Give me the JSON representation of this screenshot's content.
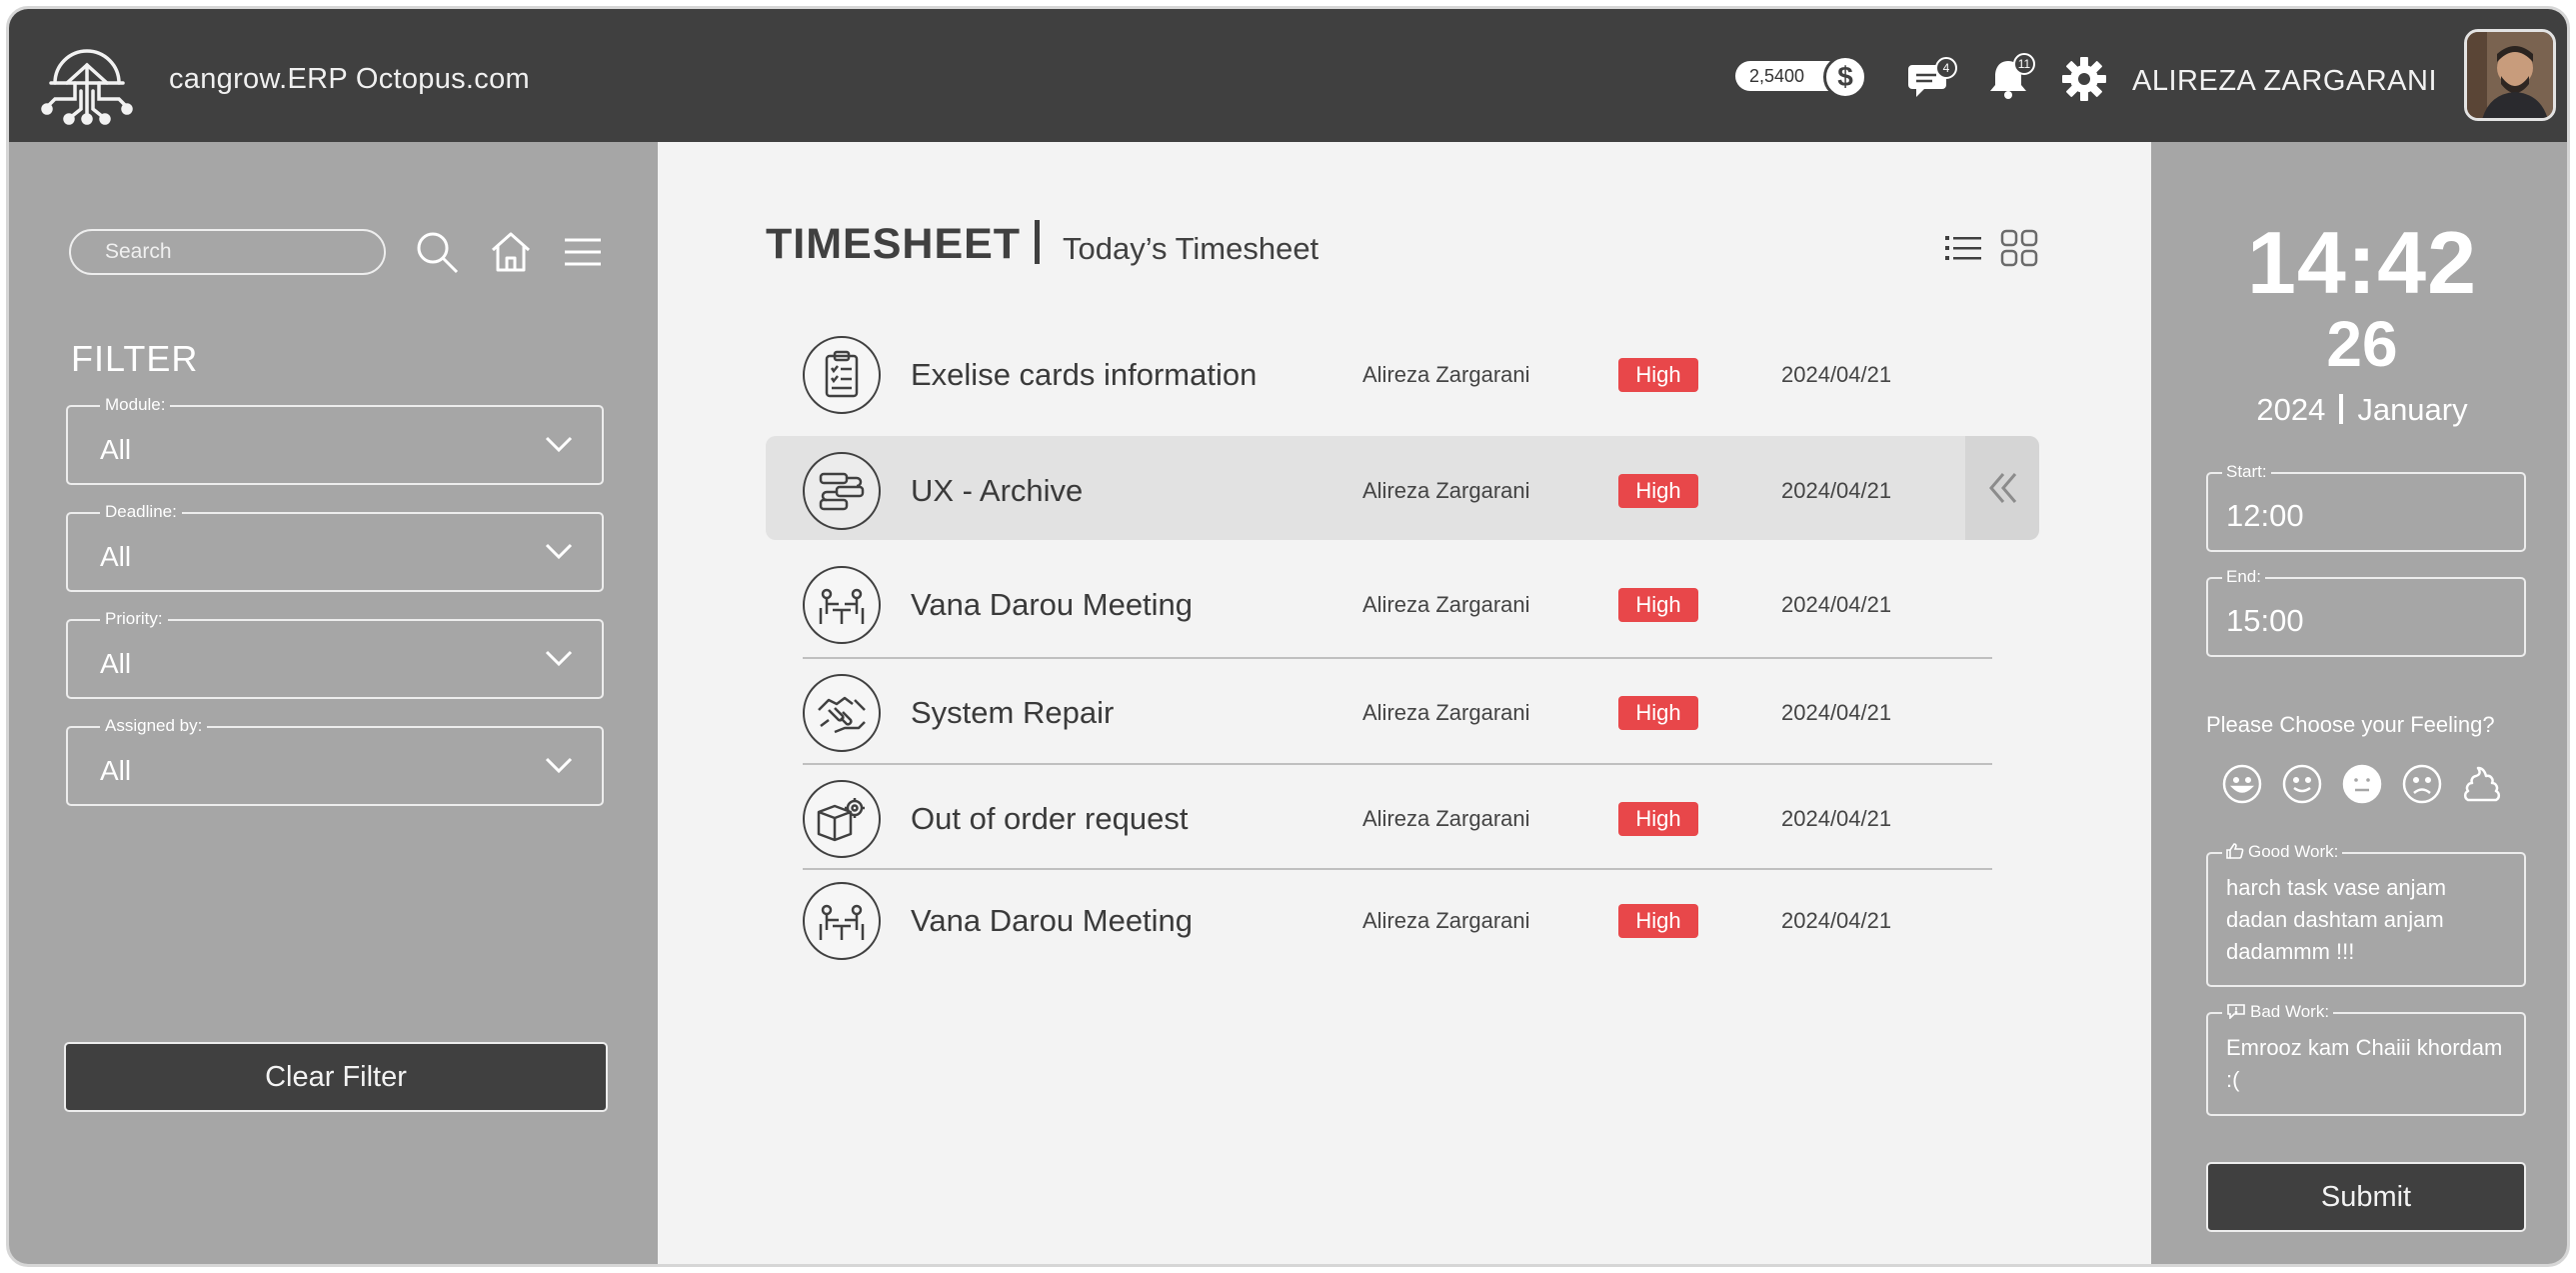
{
  "app": {
    "site_name": "cangrow.ERP Octopus.com"
  },
  "header": {
    "balance": "2,5400",
    "currency_icon": "dollar-icon",
    "messages_count": "4",
    "notifications_count": "11",
    "user_name": "ALIREZA ZARGARANI"
  },
  "sidebar": {
    "search_placeholder": "Search",
    "filter_title": "FILTER",
    "filters": [
      {
        "label": "Module:",
        "value": "All"
      },
      {
        "label": "Deadline:",
        "value": "All"
      },
      {
        "label": "Priority:",
        "value": "All"
      },
      {
        "label": "Assigned by:",
        "value": "All"
      }
    ],
    "clear_label": "Clear Filter"
  },
  "main": {
    "title": "TIMESHEET",
    "subtitle": "Today’s Timesheet",
    "tasks": [
      {
        "name": "Exelise cards information",
        "assignee": "Alireza Zargarani",
        "priority": "High",
        "date": "2024/04/21",
        "icon": "clipboard-icon"
      },
      {
        "name": "UX - Archive",
        "assignee": "Alireza Zargarani",
        "priority": "High",
        "date": "2024/04/21",
        "icon": "workflow-icon"
      },
      {
        "name": "Vana Darou Meeting",
        "assignee": "Alireza Zargarani",
        "priority": "High",
        "date": "2024/04/21",
        "icon": "meeting-icon"
      },
      {
        "name": "System Repair",
        "assignee": "Alireza Zargarani",
        "priority": "High",
        "date": "2024/04/21",
        "icon": "handshake-icon"
      },
      {
        "name": "Out of order request",
        "assignee": "Alireza Zargarani",
        "priority": "High",
        "date": "2024/04/21",
        "icon": "box-gear-icon"
      },
      {
        "name": "Vana Darou Meeting",
        "assignee": "Alireza Zargarani",
        "priority": "High",
        "date": "2024/04/21",
        "icon": "meeting-icon"
      }
    ]
  },
  "panel": {
    "time": "14:42",
    "day": "26",
    "year": "2024",
    "month": "January",
    "start_label": "Start:",
    "start_value": "12:00",
    "end_label": "End:",
    "end_value": "15:00",
    "feeling_question": "Please Choose your Feeling?",
    "good_label": "Good Work:",
    "good_text": "harch task vase anjam dadan dashtam anjam dadammm !!!",
    "bad_label": "Bad Work:",
    "bad_text": "Emrooz kam Chaiii khordam :(",
    "submit_label": "Submit"
  },
  "colors": {
    "topbar": "#404040",
    "sidebar": "#a6a6a6",
    "main_bg": "#f3f3f3",
    "priority_high": "#e8474a"
  }
}
